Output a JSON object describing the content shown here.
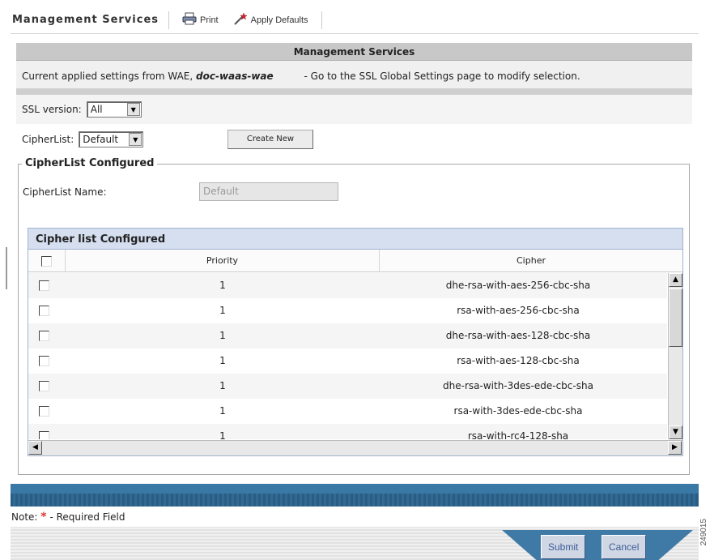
{
  "toolbar": {
    "title": "Management Services",
    "print_label": "Print",
    "apply_defaults_label": "Apply Defaults"
  },
  "section": {
    "header": "Management Services",
    "current_prefix": "Current applied settings from WAE,",
    "current_host": "doc-waas-wae",
    "current_suffix": "- Go to the SSL Global Settings page to modify selection."
  },
  "ssl_version": {
    "label": "SSL version:",
    "value": "All"
  },
  "cipherlist": {
    "label": "CipherList:",
    "value": "Default",
    "create_new_label": "Create New"
  },
  "configured": {
    "legend": "CipherList Configured",
    "name_label": "CipherList Name:",
    "name_value": "Default"
  },
  "cipher_table": {
    "title": "Cipher list Configured",
    "columns": [
      "Priority",
      "Cipher"
    ],
    "rows": [
      {
        "priority": "1",
        "cipher": "dhe-rsa-with-aes-256-cbc-sha"
      },
      {
        "priority": "1",
        "cipher": "rsa-with-aes-256-cbc-sha"
      },
      {
        "priority": "1",
        "cipher": "dhe-rsa-with-aes-128-cbc-sha"
      },
      {
        "priority": "1",
        "cipher": "rsa-with-aes-128-cbc-sha"
      },
      {
        "priority": "1",
        "cipher": "dhe-rsa-with-3des-ede-cbc-sha"
      },
      {
        "priority": "1",
        "cipher": "rsa-with-3des-ede-cbc-sha"
      },
      {
        "priority": "1",
        "cipher": "rsa-with-rc4-128-sha"
      }
    ]
  },
  "note": {
    "prefix": "Note:",
    "star": "*",
    "text": "- Required Field"
  },
  "footer": {
    "submit_label": "Submit",
    "cancel_label": "Cancel"
  },
  "figure_id": "249015",
  "icons": {
    "print": "printer-icon",
    "apply_defaults": "wand-icon",
    "dropdown": "chevron-down-icon",
    "scroll_up": "arrow-up-icon",
    "scroll_down": "arrow-down-icon",
    "scroll_left": "arrow-left-icon",
    "scroll_right": "arrow-right-icon"
  },
  "colors": {
    "header_band": "#c8c8c8",
    "table_title_bg": "#d5dff0",
    "blue_bar": "#2a5d84",
    "required_star": "#e53030",
    "footer_button_text": "#3c5c97"
  }
}
